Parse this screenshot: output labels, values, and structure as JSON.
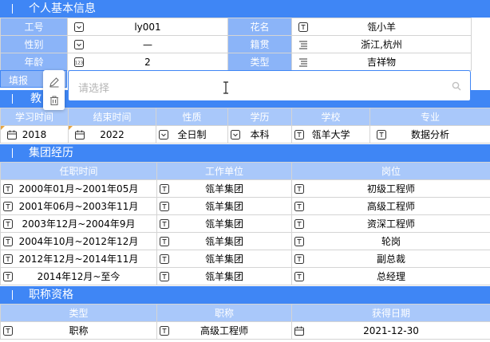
{
  "personal": {
    "title": "个人基本信息",
    "rows": [
      {
        "l1": "工号",
        "i1": "dropdown",
        "v1": "ly001",
        "l2": "花名",
        "i2": "text",
        "v2": "瓴小羊"
      },
      {
        "l1": "性别",
        "i1": "dropdown",
        "v1": "—",
        "l2": "籍贯",
        "i2": "list",
        "v2": "浙江,杭州"
      },
      {
        "l1": "年龄",
        "i1": "number",
        "v1": "2",
        "l2": "类型",
        "i2": "text",
        "v2": "吉祥物"
      }
    ],
    "fill_label": "填报"
  },
  "education": {
    "title": "教",
    "headers": [
      "学习时间",
      "结束时间",
      "性质",
      "学历",
      "学校",
      "专业"
    ],
    "row": [
      {
        "icon": "calendar",
        "value": "2018"
      },
      {
        "icon": "calendar",
        "value": "2022"
      },
      {
        "icon": "dropdown",
        "value": "全日制"
      },
      {
        "icon": "dropdown",
        "value": "本科"
      },
      {
        "icon": "text",
        "value": "瓴羊大学"
      },
      {
        "icon": "text",
        "value": "数据分析"
      }
    ]
  },
  "group": {
    "title": "集团经历",
    "headers": [
      "任职时间",
      "工作单位",
      "岗位"
    ],
    "rows": [
      [
        "2000年01月~2001年05月",
        "瓴羊集团",
        "初级工程师"
      ],
      [
        "2001年06月~2003年11月",
        "瓴羊集团",
        "高级工程师"
      ],
      [
        "2003年12月~2004年9月",
        "瓴羊集团",
        "资深工程师"
      ],
      [
        "2004年10月~2012年12月",
        "瓴羊集团",
        "轮岗"
      ],
      [
        "2012年12月~2014年11月",
        "瓴羊集团",
        "副总裁"
      ],
      [
        "2014年12月~至今",
        "瓴羊集团",
        "总经理"
      ]
    ]
  },
  "title_qual": {
    "title": "职称资格",
    "headers": [
      "类型",
      "职称",
      "获得日期"
    ],
    "row": [
      "职称",
      "高级工程师",
      "2021-12-30"
    ]
  },
  "popup": {
    "placeholder": "请选择",
    "edit_icon": "pencil-icon",
    "delete_icon": "trash-icon",
    "search_icon": "search-icon"
  },
  "colors": {
    "header_blue": "#3f86f5",
    "label_blue": "#8bb4f8",
    "subheader_blue": "#a9c8fa",
    "corner_orange": "#e6a23c"
  }
}
